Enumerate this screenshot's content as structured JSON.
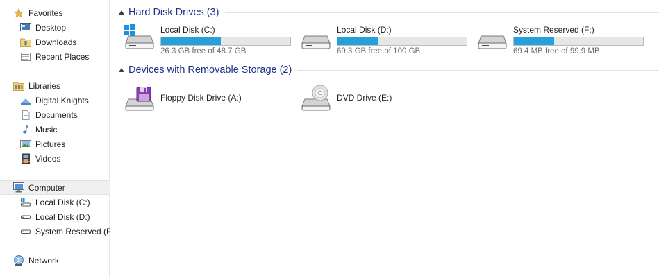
{
  "nav": {
    "favorites": {
      "label": "Favorites",
      "items": [
        {
          "label": "Desktop"
        },
        {
          "label": "Downloads"
        },
        {
          "label": "Recent Places"
        }
      ]
    },
    "libraries": {
      "label": "Libraries",
      "items": [
        {
          "label": "Digital Knights"
        },
        {
          "label": "Documents"
        },
        {
          "label": "Music"
        },
        {
          "label": "Pictures"
        },
        {
          "label": "Videos"
        }
      ]
    },
    "computer": {
      "label": "Computer",
      "items": [
        {
          "label": "Local Disk (C:)"
        },
        {
          "label": "Local Disk (D:)"
        },
        {
          "label": "System Reserved (F:)"
        }
      ]
    },
    "network": {
      "label": "Network"
    }
  },
  "groups": {
    "hard_disks": {
      "title": "Hard Disk Drives (3)",
      "drives": [
        {
          "name": "Local Disk (C:)",
          "free_text": "26.3 GB free of 48.7 GB",
          "used_fraction": 0.46
        },
        {
          "name": "Local Disk (D:)",
          "free_text": "69.3 GB free of 100 GB",
          "used_fraction": 0.31
        },
        {
          "name": "System Reserved (F:)",
          "free_text": "69.4 MB free of 99.9 MB",
          "used_fraction": 0.31
        }
      ]
    },
    "removable": {
      "title": "Devices with Removable Storage (2)",
      "devices": [
        {
          "name": "Floppy Disk Drive (A:)"
        },
        {
          "name": "DVD Drive (E:)"
        }
      ]
    }
  },
  "colors": {
    "bar_fill": "#26a0da",
    "header_text": "#1e3287"
  }
}
